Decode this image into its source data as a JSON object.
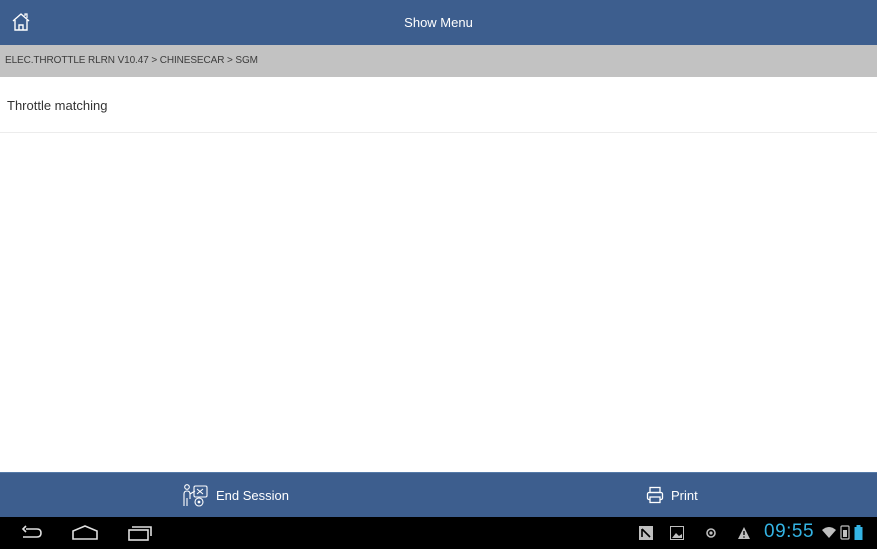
{
  "header": {
    "title": "Show Menu",
    "home_icon": "home-icon"
  },
  "breadcrumb": "ELEC.THROTTLE RLRN V10.47 > CHINESECAR > SGM",
  "menu": {
    "items": [
      {
        "label": "Throttle matching"
      }
    ]
  },
  "footer": {
    "end_session_label": "End Session",
    "print_label": "Print"
  },
  "system_bar": {
    "clock": "09:55",
    "clock_color": "#34b4e4"
  },
  "colors": {
    "bar": "#3d5e8e",
    "breadcrumb_bg": "#c2c2c2"
  }
}
